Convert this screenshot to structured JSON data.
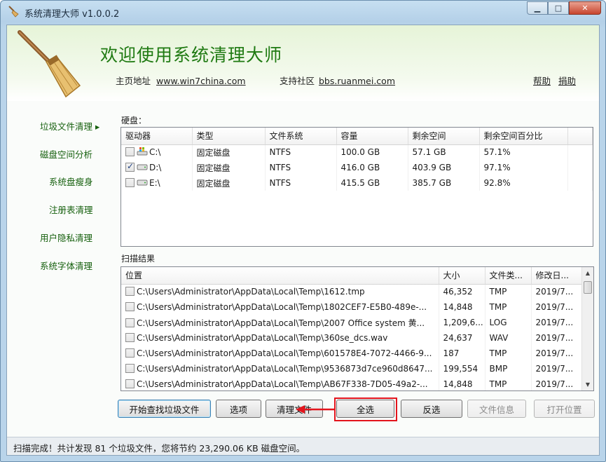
{
  "window": {
    "title": "系统清理大师 v1.0.0.2",
    "buttons": {
      "minimize": "▭",
      "maximize": "□",
      "close": "✕"
    }
  },
  "header": {
    "welcome": "欢迎使用系统清理大师",
    "homepage_label": "主页地址",
    "homepage_url": "www.win7china.com",
    "community_label": "支持社区",
    "community_url": "bbs.ruanmei.com",
    "help": "帮助",
    "donate": "捐助"
  },
  "nav": {
    "items": [
      {
        "label": "垃圾文件清理 ▸"
      },
      {
        "label": "磁盘空间分析"
      },
      {
        "label": "系统盘瘦身"
      },
      {
        "label": "注册表清理"
      },
      {
        "label": "用户隐私清理"
      },
      {
        "label": "系统字体清理"
      }
    ]
  },
  "disks": {
    "label": "硬盘：",
    "columns": [
      "驱动器",
      "类型",
      "文件系统",
      "容量",
      "剩余空间",
      "剩余空间百分比"
    ],
    "rows": [
      {
        "checked": false,
        "drive": "C:\\",
        "type": "固定磁盘",
        "fs": "NTFS",
        "capacity": "100.0 GB",
        "free": "57.1 GB",
        "percent": "57.1%"
      },
      {
        "checked": true,
        "drive": "D:\\",
        "type": "固定磁盘",
        "fs": "NTFS",
        "capacity": "416.0 GB",
        "free": "403.9 GB",
        "percent": "97.1%"
      },
      {
        "checked": false,
        "drive": "E:\\",
        "type": "固定磁盘",
        "fs": "NTFS",
        "capacity": "415.5 GB",
        "free": "385.7 GB",
        "percent": "92.8%"
      }
    ]
  },
  "results": {
    "label": "扫描结果",
    "columns": [
      "位置",
      "大小",
      "文件类...",
      "修改日..."
    ],
    "rows": [
      {
        "path": "C:\\Users\\Administrator\\AppData\\Local\\Temp\\1612.tmp",
        "size": "46,352",
        "type": "TMP",
        "date": "2019/7..."
      },
      {
        "path": "C:\\Users\\Administrator\\AppData\\Local\\Temp\\1802CEF7-E5B0-489e-...",
        "size": "14,848",
        "type": "TMP",
        "date": "2019/7..."
      },
      {
        "path": "C:\\Users\\Administrator\\AppData\\Local\\Temp\\2007 Office system 黄...",
        "size": "1,209,6...",
        "type": "LOG",
        "date": "2019/7..."
      },
      {
        "path": "C:\\Users\\Administrator\\AppData\\Local\\Temp\\360se_dcs.wav",
        "size": "24,637",
        "type": "WAV",
        "date": "2019/7..."
      },
      {
        "path": "C:\\Users\\Administrator\\AppData\\Local\\Temp\\601578E4-7072-4466-9...",
        "size": "187",
        "type": "TMP",
        "date": "2019/7..."
      },
      {
        "path": "C:\\Users\\Administrator\\AppData\\Local\\Temp\\9536873d7ce960d8647...",
        "size": "199,554",
        "type": "BMP",
        "date": "2019/7..."
      },
      {
        "path": "C:\\Users\\Administrator\\AppData\\Local\\Temp\\AB67F338-7D05-49a2-...",
        "size": "14,848",
        "type": "TMP",
        "date": "2019/7..."
      }
    ]
  },
  "buttons": {
    "scan": "开始查找垃圾文件",
    "options": "选项",
    "clean": "清理文件",
    "select_all": "全选",
    "invert": "反选",
    "file_info": "文件信息",
    "open_location": "打开位置"
  },
  "status": "扫描完成！共计发现 81 个垃圾文件，您将节约 23,290.06 KB 磁盘空间。",
  "colors": {
    "accent_green": "#1f7a12",
    "highlight_red": "#e3141c"
  }
}
